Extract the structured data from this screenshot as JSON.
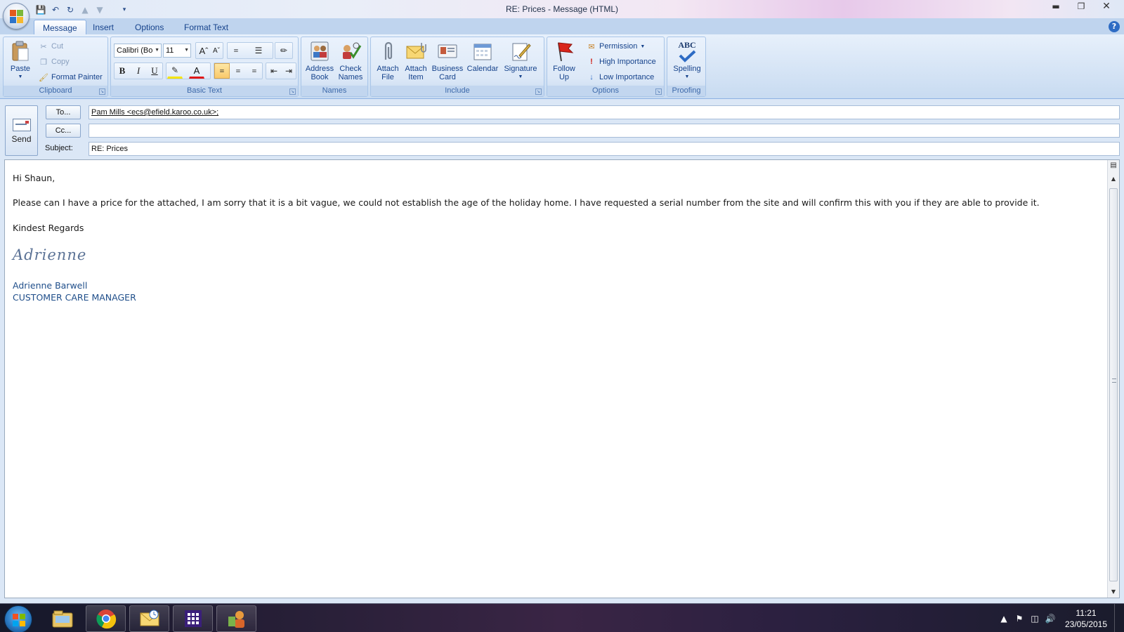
{
  "window": {
    "title": "RE: Prices - Message (HTML)",
    "controls": [
      "minimize",
      "restore",
      "close"
    ]
  },
  "quick_access": [
    "save-icon",
    "undo-icon",
    "redo-icon",
    "up-arrow-icon",
    "down-arrow-icon",
    "customize-icon"
  ],
  "tabs": [
    {
      "label": "Message",
      "active": true
    },
    {
      "label": "Insert"
    },
    {
      "label": "Options"
    },
    {
      "label": "Format Text"
    }
  ],
  "ribbon": {
    "clipboard": {
      "label": "Clipboard",
      "paste": "Paste",
      "cut": "Cut",
      "copy": "Copy",
      "format_painter": "Format Painter"
    },
    "basic_text": {
      "label": "Basic Text",
      "font": "Calibri (Bo",
      "size": "11",
      "bold": "B",
      "italic": "I",
      "underline": "U",
      "font_color_letter": "A"
    },
    "names": {
      "label": "Names",
      "address_book": [
        "Address",
        "Book"
      ],
      "check_names": [
        "Check",
        "Names"
      ]
    },
    "include": {
      "label": "Include",
      "attach_file": [
        "Attach",
        "File"
      ],
      "attach_item": [
        "Attach",
        "Item"
      ],
      "business_card": [
        "Business",
        "Card"
      ],
      "calendar": "Calendar",
      "signature": "Signature"
    },
    "options": {
      "label": "Options",
      "follow_up": [
        "Follow",
        "Up"
      ],
      "permission": "Permission",
      "high_importance": "High Importance",
      "low_importance": "Low Importance"
    },
    "proofing": {
      "label": "Proofing",
      "spelling": "Spelling",
      "spelling_icon_text": "ABC"
    }
  },
  "header": {
    "send_label": "Send",
    "to_button": "To...",
    "cc_button": "Cc...",
    "subject_label": "Subject:",
    "to_value": "Pam Mills <ecs@efield.karoo.co.uk>;",
    "cc_value": "",
    "subject_value": "RE: Prices"
  },
  "body": {
    "greeting": "Hi Shaun,",
    "paragraph": "Please can I have a price for the attached, I am sorry that it is a bit vague, we could not establish the age of the holiday home.  I have requested a serial number from the site and will confirm this with you if they are able to provide it.",
    "closing": "Kindest Regards",
    "signature_script": "Adrienne",
    "signature_name": "Adrienne Barwell",
    "signature_title": "CUSTOMER CARE MANAGER"
  },
  "taskbar": {
    "apps": [
      "windows-explorer-icon",
      "chrome-icon",
      "outlook-icon",
      "app-grid-icon",
      "contact-icon"
    ],
    "time": "11:21",
    "date": "23/05/2015"
  }
}
